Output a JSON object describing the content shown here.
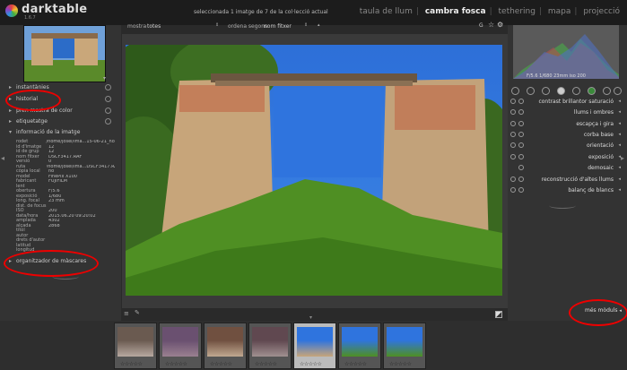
{
  "app": {
    "name": "darktable",
    "version": "1.6.7"
  },
  "status": "seleccionada 1 imatge de 7 de la col·lecció actual",
  "views": [
    "taula de llum",
    "cambra fosca",
    "tethering",
    "mapa",
    "projecció"
  ],
  "active_view": "cambra fosca",
  "center_toolbar": {
    "mostra_label": "mostra",
    "mostra_value": "totes",
    "ordena_label": "ordena segons",
    "ordena_value": "nom fitxer",
    "g_label": "G"
  },
  "left_sections": [
    {
      "label": "instantànies"
    },
    {
      "label": "historial"
    },
    {
      "label": "pren mostra de color"
    },
    {
      "label": "etiquetatge"
    },
    {
      "label": "informació de la imatge"
    }
  ],
  "image_info": [
    {
      "k": "rodet",
      "v": "/home/josei/ima...15-06-21_novo"
    },
    {
      "k": "id d'imatge",
      "v": "12"
    },
    {
      "k": "id de grup",
      "v": "12"
    },
    {
      "k": "nom fitxer",
      "v": "DSCF3417.RAF"
    },
    {
      "k": "versió",
      "v": "0"
    },
    {
      "k": "ruta",
      "v": "/home/josei/ima...DSCF3417.RAF"
    },
    {
      "k": "còpia local",
      "v": "no"
    },
    {
      "k": "model",
      "v": "FinePix X100"
    },
    {
      "k": "fabricant",
      "v": "FUJIFILM"
    },
    {
      "k": "lent",
      "v": ""
    },
    {
      "k": "obertura",
      "v": "F/5.6"
    },
    {
      "k": "exposició",
      "v": "1/680"
    },
    {
      "k": "long. focal",
      "v": "23 mm"
    },
    {
      "k": "dist. de focus",
      "v": ""
    },
    {
      "k": "ISO",
      "v": "200"
    },
    {
      "k": "data/hora",
      "v": "2015.06.20 09:20:02"
    },
    {
      "k": "amplada",
      "v": "4302"
    },
    {
      "k": "alçada",
      "v": "2868"
    },
    {
      "k": "títol",
      "v": ""
    },
    {
      "k": "autor",
      "v": ""
    },
    {
      "k": "drets d'autor",
      "v": ""
    },
    {
      "k": "latitud",
      "v": ""
    },
    {
      "k": "longitud",
      "v": ""
    }
  ],
  "mask_manager": {
    "label": "organitzador de màscares"
  },
  "histogram_info": "F/5.6 1/680 23mm iso 200",
  "modules": [
    "contrast brillantor saturació",
    "llums i ombres",
    "escapça i gira",
    "corba base",
    "orientació",
    "exposició",
    "demosaic",
    "reconstrucció d'altes llums",
    "balanç de blancs"
  ],
  "more_modules": "més mòduls",
  "filmstrip": {
    "count": 7,
    "selected_index": 4,
    "stars": "☆☆☆☆☆"
  },
  "colors": {
    "annotation": "#e00000",
    "panel": "#333333",
    "topbar": "#1c1c1c"
  }
}
